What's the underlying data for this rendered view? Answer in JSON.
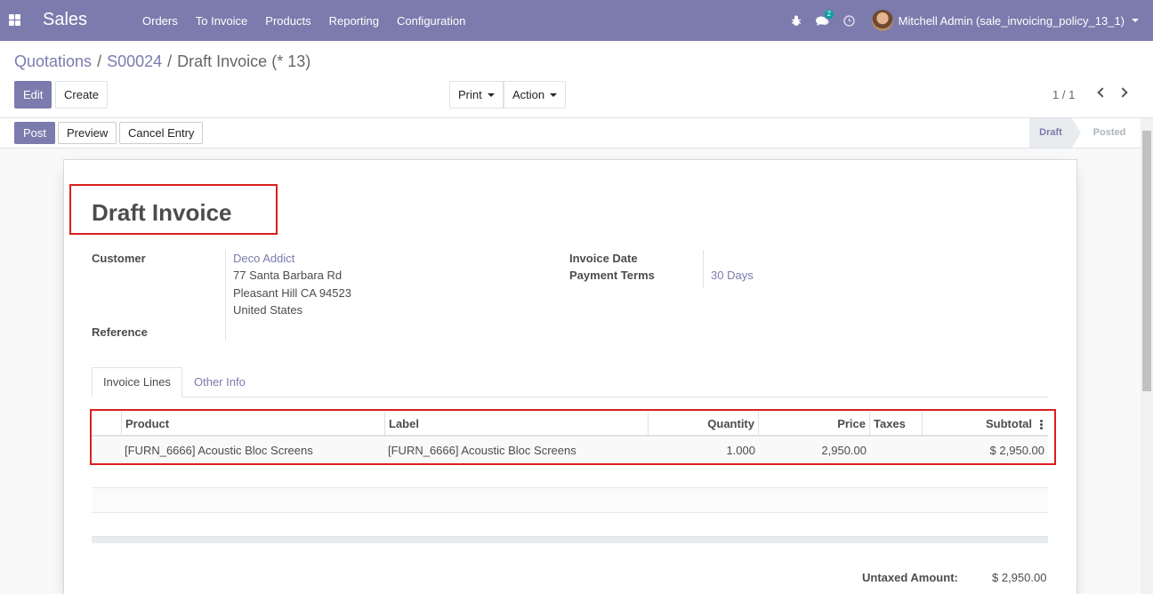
{
  "navbar": {
    "brand": "Sales",
    "menu": [
      "Orders",
      "To Invoice",
      "Products",
      "Reporting",
      "Configuration"
    ],
    "chat_badge": "2",
    "user_name": "Mitchell Admin (sale_invoicing_policy_13_1)",
    "color": "#7c7bad"
  },
  "breadcrumb": {
    "items": [
      "Quotations",
      "S00024"
    ],
    "current": "Draft Invoice (* 13)"
  },
  "controls": {
    "edit": "Edit",
    "create": "Create",
    "print": "Print",
    "action": "Action",
    "pager": "1 / 1"
  },
  "statusbar": {
    "post": "Post",
    "preview": "Preview",
    "cancel_entry": "Cancel Entry",
    "stages": [
      "Draft",
      "Posted"
    ],
    "active_stage": "Draft"
  },
  "invoice": {
    "title": "Draft Invoice",
    "customer_label": "Customer",
    "customer_name": "Deco Addict",
    "address": [
      "77 Santa Barbara Rd",
      "Pleasant Hill CA 94523",
      "United States"
    ],
    "reference_label": "Reference",
    "invoice_date_label": "Invoice Date",
    "payment_terms_label": "Payment Terms",
    "payment_terms": "30 Days"
  },
  "tabs": [
    "Invoice Lines",
    "Other Info"
  ],
  "lines": {
    "columns": [
      "Product",
      "Label",
      "Quantity",
      "Price",
      "Taxes",
      "Subtotal"
    ],
    "rows": [
      {
        "product": "[FURN_6666] Acoustic Bloc Screens",
        "label": "[FURN_6666] Acoustic Bloc Screens",
        "quantity": "1.000",
        "price": "2,950.00",
        "taxes": "",
        "subtotal": "$ 2,950.00"
      }
    ]
  },
  "totals": {
    "untaxed_label": "Untaxed Amount:",
    "untaxed_value": "$ 2,950.00"
  },
  "icons": {
    "apps": "apps-grid-icon",
    "bug": "bug-icon",
    "chat": "chat-icon",
    "clock": "clock-icon",
    "prev": "chevron-left-icon",
    "next": "chevron-right-icon",
    "optional_columns": "kebab-icon"
  },
  "highlight_color": "#dc1e1e"
}
